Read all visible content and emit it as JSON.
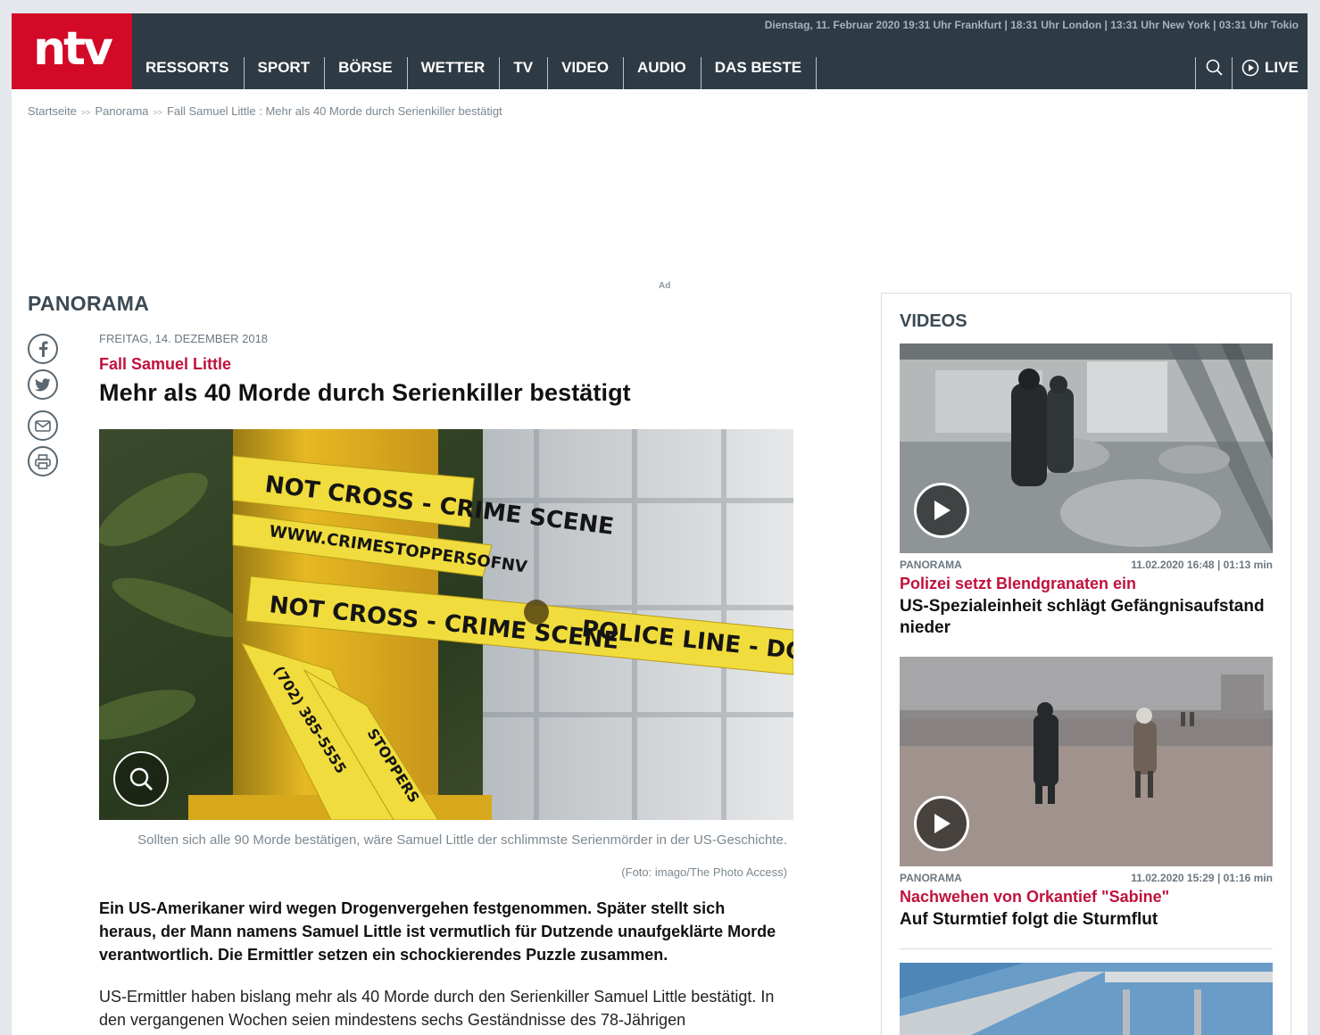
{
  "header": {
    "logo": "ntv",
    "topline": "Dienstag, 11. Februar 2020  19:31 Uhr Frankfurt | 18:31 Uhr London | 13:31 Uhr New York  | 03:31 Uhr Tokio",
    "nav": [
      "RESSORTS",
      "SPORT",
      "BÖRSE",
      "WETTER",
      "TV",
      "VIDEO",
      "AUDIO",
      "DAS BESTE"
    ],
    "live_label": "LIVE"
  },
  "breadcrumb": {
    "items": [
      "Startseite",
      "Panorama",
      "Fall Samuel Little : Mehr als 40 Morde durch Serienkiller bestätigt"
    ],
    "separator": ">>"
  },
  "ad_label": "Ad",
  "section_title": "PANORAMA",
  "article": {
    "date": "FREITAG, 14. DEZEMBER 2018",
    "kicker": "Fall Samuel Little",
    "title": "Mehr als 40 Morde durch Serienkiller bestätigt",
    "caption": "Sollten sich alle 90 Morde bestätigen, wäre Samuel Little der schlimmste Serienmörder in der US-Geschichte.",
    "credit": "(Foto: imago/The Photo Access)",
    "lead": "Ein US-Amerikaner wird wegen Drogenvergehen festgenommen. Später stellt sich heraus, der Mann namens Samuel Little ist vermutlich für Dutzende unaufgeklärte Morde verantwortlich. Die Ermittler setzen ein schockierendes Puzzle zusammen.",
    "body": "US-Ermittler haben bislang mehr als 40 Morde durch den Serienkiller Samuel Little bestätigt. In den vergangenen Wochen seien mindestens sechs Geständnisse des 78-Jährigen",
    "image_tape": {
      "line1": "NOT CROSS - CRIME SCENE",
      "line2": "WWW.CRIMESTOPPERSOFNV",
      "line3": "NOT CROSS - CRIME SCENE",
      "line4": "POLICE LINE - DO NOT",
      "line5": "(702) 385-5555",
      "line6": "STOPPERS"
    }
  },
  "sidebar": {
    "title": "VIDEOS",
    "videos": [
      {
        "section": "PANORAMA",
        "meta": "11.02.2020 16:48 | 01:13 min",
        "kicker": "Polizei setzt Blendgranaten ein",
        "title": "US-Spezialeinheit schlägt Gefängnisaufstand nieder"
      },
      {
        "section": "PANORAMA",
        "meta": "11.02.2020 15:29 | 01:16 min",
        "kicker": "Nachwehen von Orkantief \"Sabine\"",
        "title": "Auf Sturmtief folgt die Sturmflut"
      }
    ]
  },
  "colors": {
    "brand_red": "#d20a28",
    "header_bg": "#2e3b45",
    "kicker": "#c0123c"
  },
  "icons": [
    "search-icon",
    "play-circle-icon",
    "facebook-icon",
    "twitter-icon",
    "mail-icon",
    "print-icon",
    "zoom-icon",
    "play-icon"
  ]
}
